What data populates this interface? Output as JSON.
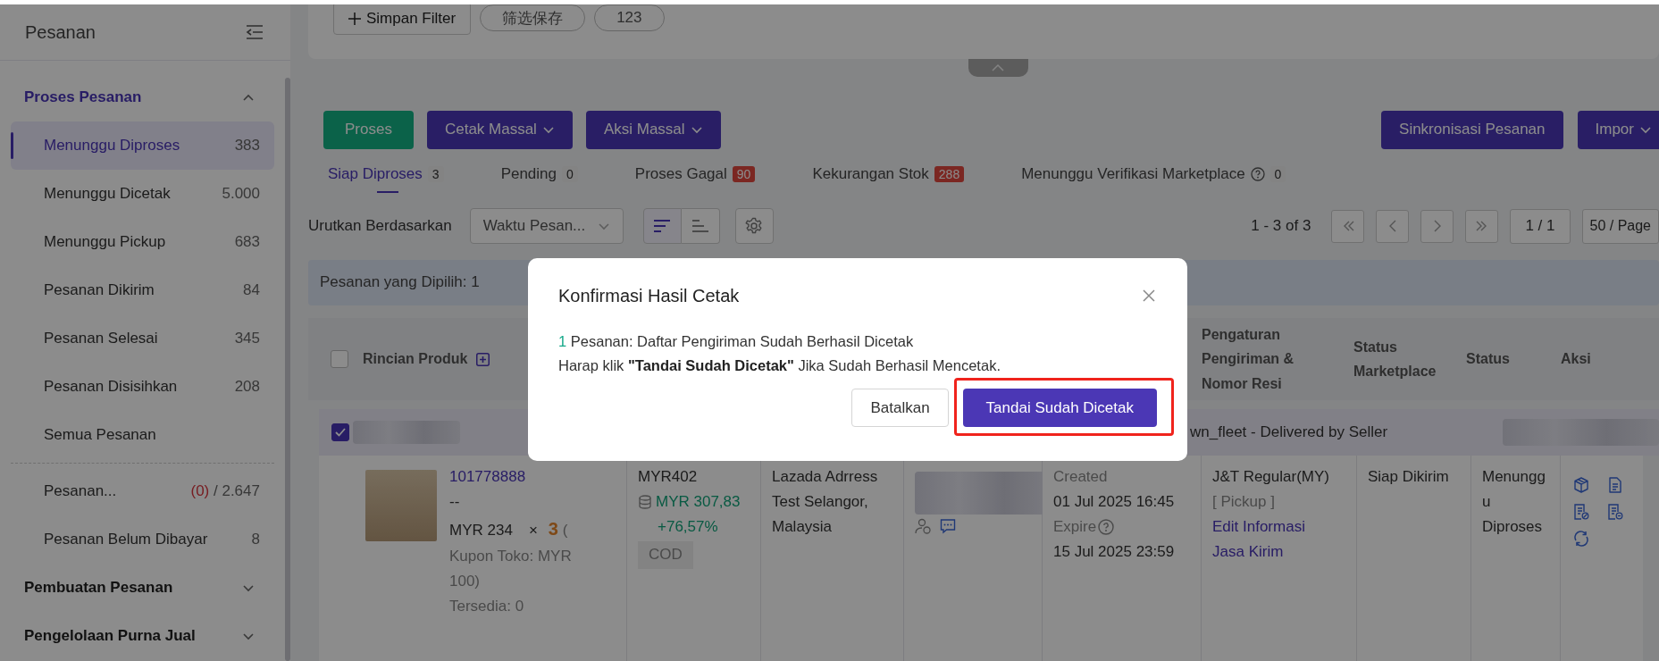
{
  "sidebar": {
    "title": "Pesanan",
    "groups": [
      {
        "title": "Proses Pesanan",
        "expanded": true,
        "items": [
          {
            "label": "Menunggu Diproses",
            "count": "383",
            "selected": true
          },
          {
            "label": "Menunggu Dicetak",
            "count": "5.000",
            "selected": false
          },
          {
            "label": "Menunggu Pickup",
            "count": "683",
            "selected": false
          },
          {
            "label": "Pesanan Dikirim",
            "count": "84",
            "selected": false
          },
          {
            "label": "Pesanan Selesai",
            "count": "345",
            "selected": false
          },
          {
            "label": "Pesanan Disisihkan",
            "count": "208",
            "selected": false
          },
          {
            "label": "Semua Pesanan",
            "selected": false
          }
        ],
        "extra_items": [
          {
            "label": "Pesanan...",
            "alert_count": "(0)",
            "count": "/ 2.647",
            "selected": false
          },
          {
            "label": "Pesanan Belum Dibayar",
            "count": "8",
            "selected": false
          }
        ]
      },
      {
        "title": "Pembuatan Pesanan",
        "expanded": false
      },
      {
        "title": "Pengelolaan Purna Jual",
        "expanded": false
      }
    ]
  },
  "filter_bar": {
    "add_button": "Simpan Filter",
    "saved_filters": [
      "筛选保存",
      "123"
    ]
  },
  "actions": {
    "left": [
      {
        "label": "Proses",
        "kind": "success",
        "dropdown": false
      },
      {
        "label": "Cetak Massal",
        "kind": "primary",
        "dropdown": true
      },
      {
        "label": "Aksi Massal",
        "kind": "primary",
        "dropdown": true
      }
    ],
    "right": [
      {
        "label": "Sinkronisasi Pesanan",
        "kind": "primary",
        "dropdown": false
      },
      {
        "label": "Impor",
        "kind": "primary",
        "dropdown": true
      }
    ]
  },
  "tabs": [
    {
      "label": "Siap Diproses",
      "count": "3",
      "count_alert": false,
      "help": false,
      "selected": true
    },
    {
      "label": "Pending",
      "count": "0",
      "count_alert": false,
      "help": false,
      "selected": false
    },
    {
      "label": "Proses Gagal",
      "count": "90",
      "count_alert": true,
      "help": false,
      "selected": false
    },
    {
      "label": "Kekurangan Stok",
      "count": "288",
      "count_alert": true,
      "help": false,
      "selected": false
    },
    {
      "label": "Menunggu Verifikasi Marketplace",
      "count": "0",
      "count_alert": false,
      "help": true,
      "selected": false
    }
  ],
  "sort": {
    "label": "Urutkan Berdasarkan",
    "field": "Waktu Pesan...",
    "order": [
      {
        "kind": "desc",
        "selected": true
      },
      {
        "kind": "asc",
        "selected": false
      }
    ]
  },
  "pagination": {
    "range": "1 - 3 of 3",
    "page": "1 / 1",
    "page_size": "50 / Page"
  },
  "selection_bar": {
    "text": "Pesanan yang Dipilih: 1"
  },
  "table": {
    "header_checked": false,
    "columns": [
      {
        "label": "Rincian Produk"
      },
      {
        "label": "Pengaturan Pengiriman & Nomor Resi"
      },
      {
        "label": "Status Marketplace"
      },
      {
        "label": "Status"
      },
      {
        "label": "Aksi"
      }
    ],
    "group": {
      "checked": true,
      "shipping": "wn_fleet - Delivered by Seller"
    },
    "rows": [
      {
        "product": {
          "order_id": "101778888",
          "variant": "--",
          "price": "MYR 234",
          "times": "×",
          "qty": "3",
          "coupon": "( Kupon Toko: MYR 100)",
          "stock": "Tersedia: 0"
        },
        "payment": {
          "total": "MYR402",
          "profit": "MYR 307,83",
          "margin": "+76,57%",
          "method": "COD"
        },
        "address": "Lazada Adrress Test Selangor, Malaysia",
        "time": {
          "created_label": "Created",
          "created": "01 Jul 2025 16:45",
          "expire_label": "Expire",
          "expire": "15 Jul 2025 23:59"
        },
        "shipping": {
          "carrier": "J&T Regular(MY)",
          "mode": "[ Pickup ]",
          "link": "Edit Informasi Jasa Kirim"
        },
        "marketplace_status": "Siap Dikirim",
        "status": "Menunggu Diproses"
      }
    ]
  },
  "dialog": {
    "title": "Konfirmasi Hasil Cetak",
    "count": "1",
    "message": "Pesanan: Daftar Pengiriman Sudah Berhasil Dicetak",
    "hint": "Harap klik **\"Tandai Sudah Dicetak\"** Jika Sudah Berhasil Mencetak.",
    "cancel": "Batalkan",
    "confirm": "Tandai Sudah Dicetak",
    "confirm_highlighted": true
  }
}
